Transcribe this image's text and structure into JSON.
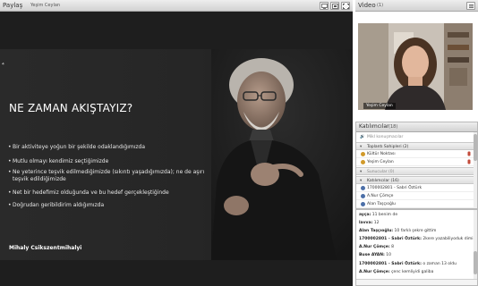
{
  "share_pod": {
    "title": "Paylaş",
    "presenter": "Yeşim Ceylan",
    "icons": [
      "screen-icon",
      "fit-icon",
      "fullscreen-icon"
    ]
  },
  "slide": {
    "corner_mark": "⁴",
    "title": "NE ZAMAN AKIŞTAYIZ?",
    "bullets": [
      "Bir aktiviteye yoğun bir şekilde odaklandığımızda",
      "Mutlu olmayı kendimiz seçtiğimizde",
      "Ne yeterince teşvik edilmediğimizde (sıkıntı yaşadığımızda); ne de aşırı teşvik edildiğimizde",
      "Net bir hedefimiz olduğunda ve bu hedef gerçekleştiğinde",
      "Doğrudan geribildirim aldığımızda"
    ],
    "author": "Mihaly Csikszentmihalyi"
  },
  "video_pod": {
    "title": "Video",
    "count": "(1)",
    "name_tag": "Yeşim Ceylan"
  },
  "attendees_pod": {
    "title": "Katılımcılar",
    "count": "(18)",
    "mute_label": "Mikl konuşmacılar",
    "hosts_label": "Toplantı Sahipleri (2)",
    "hosts": [
      "Kültür Noktası",
      "Yeşim Ceylan"
    ],
    "presenters_label": "Sunucular (0)",
    "participants_label": "Katılımcılar (16)",
    "participants": [
      "1700002801 - Sabri Öztürk",
      "A.Nur Çömçe",
      "Alan Taşçıoğlu"
    ]
  },
  "chat_pod": {
    "lines": [
      {
        "who": "ayça:",
        "text": " 11 benim de"
      },
      {
        "who": "lavva:",
        "text": " 12"
      },
      {
        "who": "Alan Taşçıoğlu:",
        "text": " 10 farklı şekre gittim"
      },
      {
        "who": "1700002801 - Sabri Öztürk:",
        "text": " 2kere yazabiliyoduk dimi"
      },
      {
        "who": "A.Nur Çömçe:",
        "text": " 8"
      },
      {
        "who": "Buse AYAN:",
        "text": " 10"
      },
      {
        "who": "1700002801 - Sabri Öztürk:",
        "text": " o zaman 13 oldu"
      },
      {
        "who": "A.Nur Çömçe:",
        "text": " çenc kemliyidi galiba"
      }
    ]
  },
  "colors": {
    "slide_bg": "#262626",
    "title_bar": "#dedede",
    "host_icon": "#d19a2b",
    "participant_icon": "#4c6fa8"
  }
}
